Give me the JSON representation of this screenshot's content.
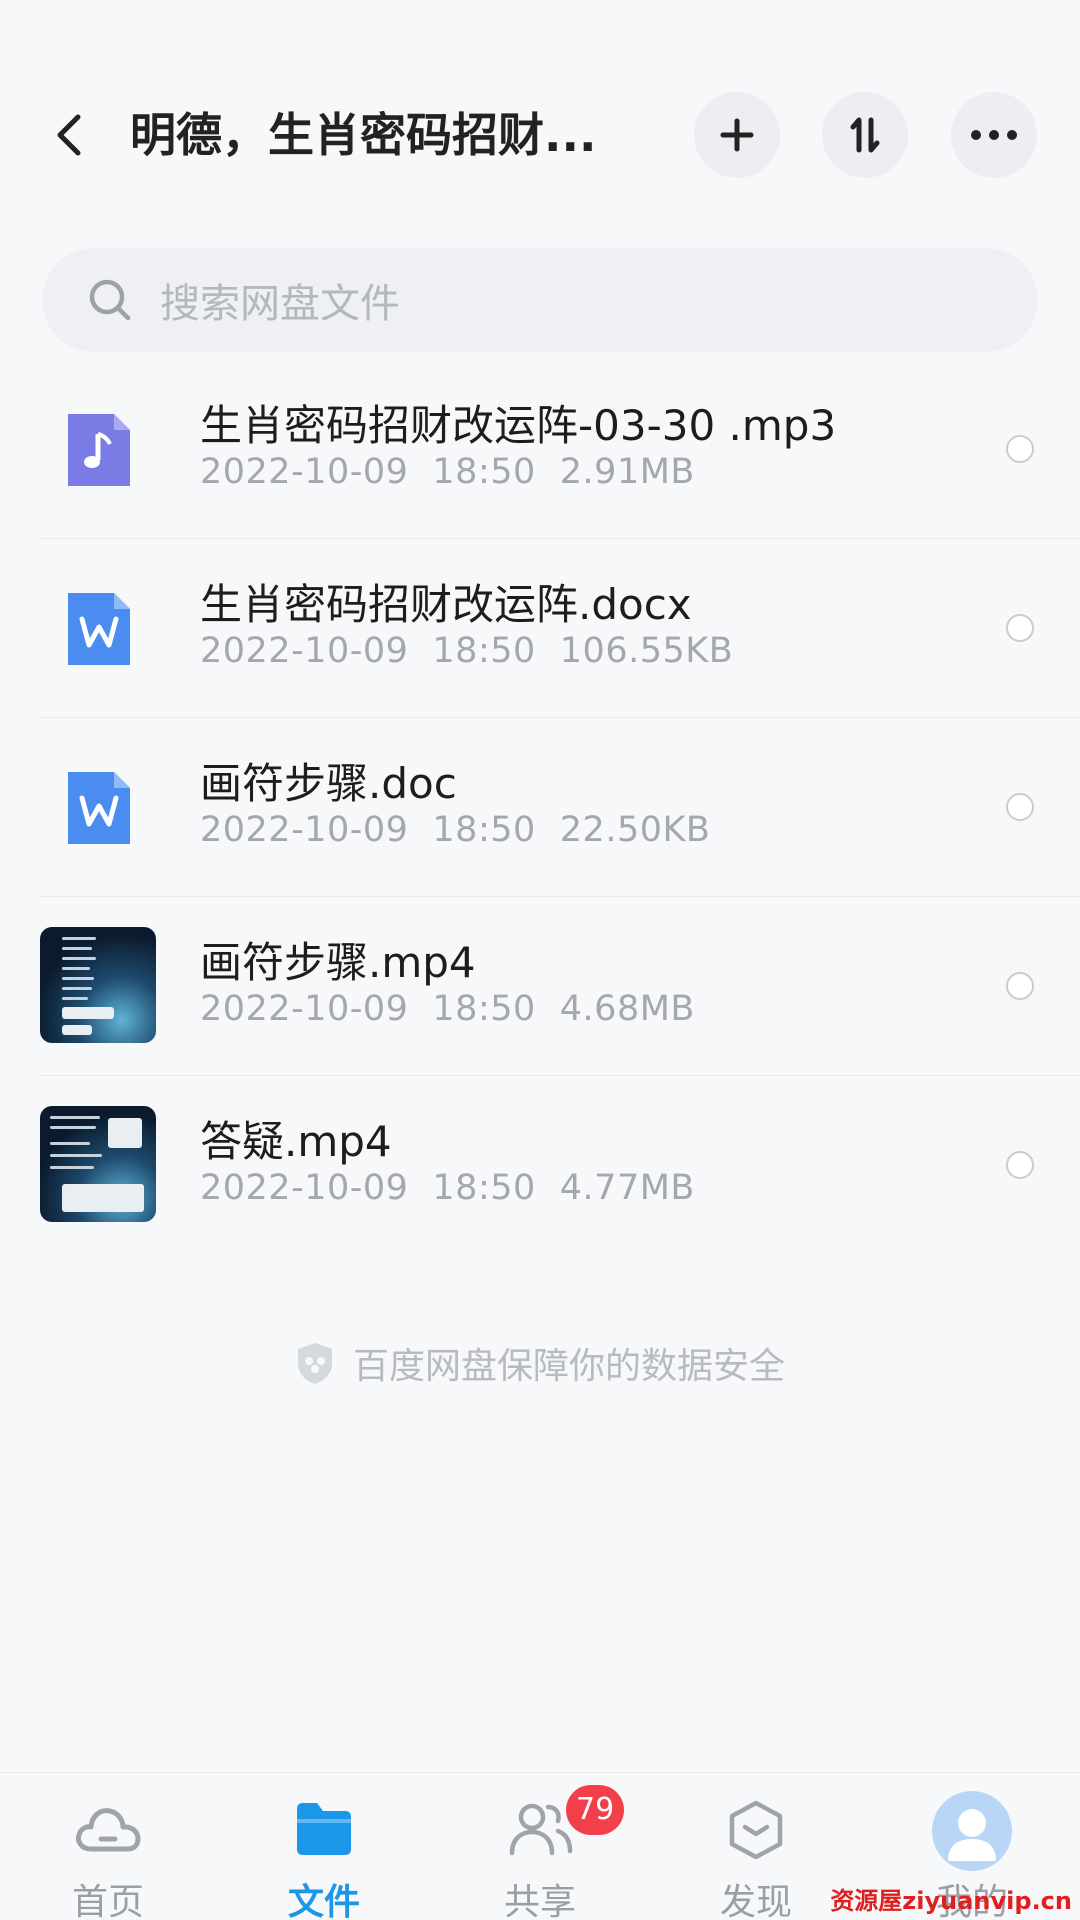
{
  "header": {
    "title": "明德，生肖密码招财..."
  },
  "search": {
    "placeholder": "搜索网盘文件"
  },
  "files": [
    {
      "name": "生肖密码招财改运阵-03-30 .mp3",
      "date": "2022-10-09",
      "time": "18:50",
      "size": "2.91MB",
      "icon": "audio-file-icon"
    },
    {
      "name": "生肖密码招财改运阵.docx",
      "date": "2022-10-09",
      "time": "18:50",
      "size": "106.55KB",
      "icon": "word-file-icon"
    },
    {
      "name": "画符步骤.doc",
      "date": "2022-10-09",
      "time": "18:50",
      "size": "22.50KB",
      "icon": "word-file-icon"
    },
    {
      "name": "画符步骤.mp4",
      "date": "2022-10-09",
      "time": "18:50",
      "size": "4.68MB",
      "icon": "video-thumbnail"
    },
    {
      "name": "答疑.mp4",
      "date": "2022-10-09",
      "time": "18:50",
      "size": "4.77MB",
      "icon": "video-thumbnail"
    }
  ],
  "security_note": "百度网盘保障你的数据安全",
  "nav": {
    "home": "首页",
    "files": "文件",
    "share": "共享",
    "share_badge": "79",
    "discover": "发现",
    "me": "我的"
  },
  "watermark": "资源屋ziyuanvip.cn",
  "colors": {
    "accent": "#1c96e8",
    "badge": "#f2404a",
    "audio_icon": "#7b7be6",
    "word_icon": "#4a8cf0"
  }
}
